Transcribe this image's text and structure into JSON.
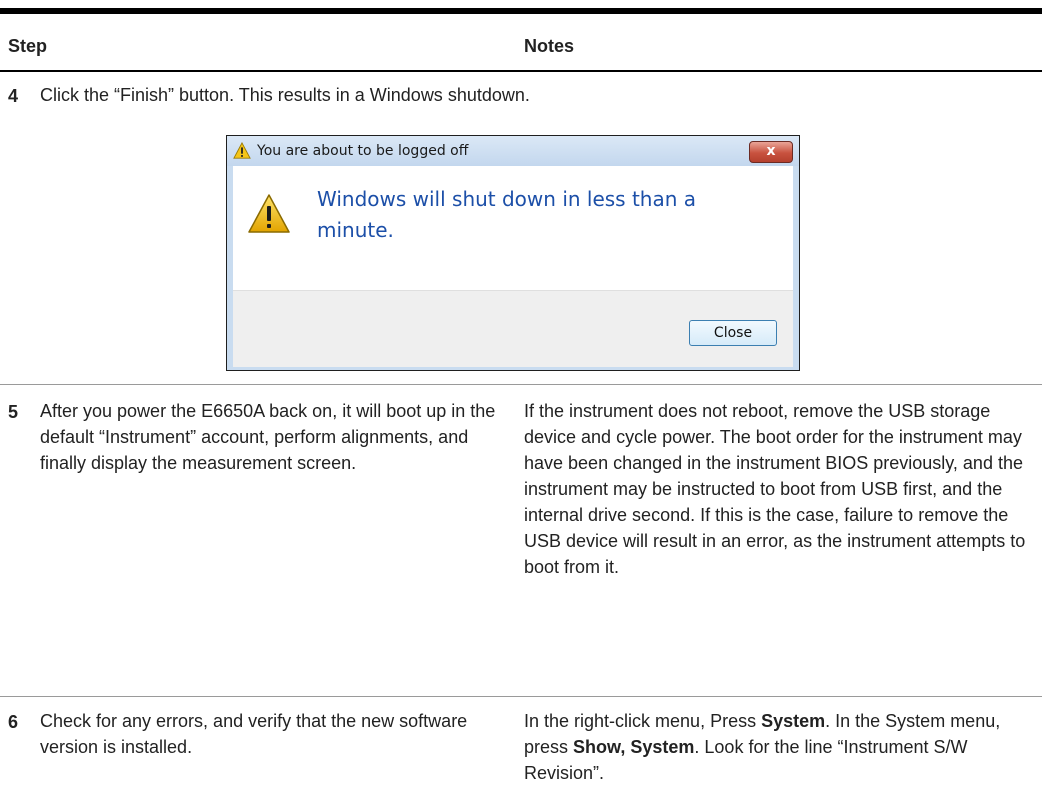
{
  "header": {
    "step": "Step",
    "notes": "Notes"
  },
  "rows": [
    {
      "num": "4",
      "step": "Click the “Finish” button. This results in a Windows shutdown."
    },
    {
      "num": "5",
      "step": "After you power the E6650A back on, it will boot up in the default “Instrument” account, perform alignments, and finally display the measurement screen.",
      "notes": "If the instrument does not reboot, remove the USB storage device and cycle power. The boot order for the instrument may have been changed in the instrument BIOS previously, and the instrument may be instructed to boot from USB first, and the internal drive second. If this is the case, failure to remove the USB device will result in an error, as the instrument attempts to boot from it."
    },
    {
      "num": "6",
      "step": "Check for any errors, and verify that the new software version is installed.",
      "notes_parts": {
        "a": "In the right-click menu, Press ",
        "b": "System",
        "c": ". In the System menu, press ",
        "d": "Show, System",
        "e": ". Look for the line “Instrument S/W Revision”."
      }
    }
  ],
  "dialog": {
    "title": "You are about to be logged off",
    "close_glyph": "x",
    "message": "Windows will shut down in less than a minute.",
    "button": "Close",
    "title_icon": "warning-icon",
    "body_icon": "warning-icon"
  }
}
